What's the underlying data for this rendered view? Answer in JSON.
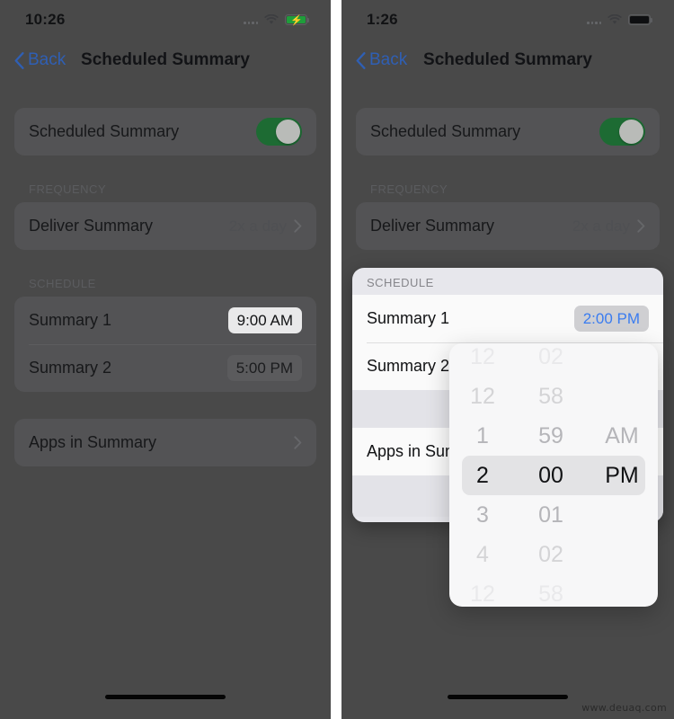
{
  "panels": [
    {
      "id": "left",
      "status": {
        "time": "10:26",
        "wifi_icon": "wifi-icon",
        "battery_icon": "battery-charging-icon",
        "signal_icon": "signal-dots-icon"
      },
      "nav": {
        "back_label": "Back",
        "back_icon": "chevron-left-icon",
        "title": "Scheduled Summary"
      },
      "toggle_row": {
        "label": "Scheduled Summary",
        "state": "on"
      },
      "frequency": {
        "header": "FREQUENCY",
        "row_label": "Deliver Summary",
        "row_value": "2x a day",
        "disclosure_icon": "chevron-right-icon"
      },
      "schedule": {
        "header": "SCHEDULE",
        "rows": [
          {
            "label": "Summary 1",
            "time": "9:00 AM",
            "highlight": "active"
          },
          {
            "label": "Summary 2",
            "time": "5:00 PM",
            "highlight": "plain"
          }
        ]
      },
      "apps_row": {
        "label": "Apps in Summary",
        "disclosure_icon": "chevron-right-icon"
      },
      "home_indicator": "home-indicator"
    },
    {
      "id": "right",
      "status": {
        "time": "1:26",
        "wifi_icon": "wifi-icon",
        "battery_icon": "battery-full-icon",
        "signal_icon": "signal-dots-icon"
      },
      "nav": {
        "back_label": "Back",
        "back_icon": "chevron-left-icon",
        "title": "Scheduled Summary"
      },
      "toggle_row": {
        "label": "Scheduled Summary",
        "state": "on"
      },
      "frequency": {
        "header": "FREQUENCY",
        "row_label": "Deliver Summary",
        "row_value": "2x a day",
        "disclosure_icon": "chevron-right-icon"
      },
      "schedule": {
        "header": "SCHEDULE",
        "rows": [
          {
            "label": "Summary 1",
            "time": "2:00 PM",
            "highlight": "blue"
          },
          {
            "label": "Summary 2",
            "time": "",
            "highlight": "none"
          }
        ]
      },
      "apps_row": {
        "label": "Apps in Sum",
        "disclosure_icon": "chevron-right-icon"
      },
      "time_picker": {
        "hours": [
          "12",
          "1",
          "2",
          "3",
          "4"
        ],
        "minutes": [
          "58",
          "59",
          "00",
          "01",
          "02"
        ],
        "meridiem": [
          "",
          "AM",
          "PM",
          "",
          ""
        ],
        "selected_hour": "2",
        "selected_minute": "00",
        "selected_meridiem": "PM",
        "selected_index": 2
      },
      "home_indicator": "home-indicator"
    }
  ],
  "watermark": "www.deuaq.com",
  "colors": {
    "page_background": "#494949",
    "card_background": "#535355",
    "toggle_on": "#1d6b33",
    "accent_blue": "#3a7cf0",
    "back_link": "#2f5fb4",
    "picker_background": "#f7f7f8",
    "popover_background": "#e7e7ec"
  }
}
